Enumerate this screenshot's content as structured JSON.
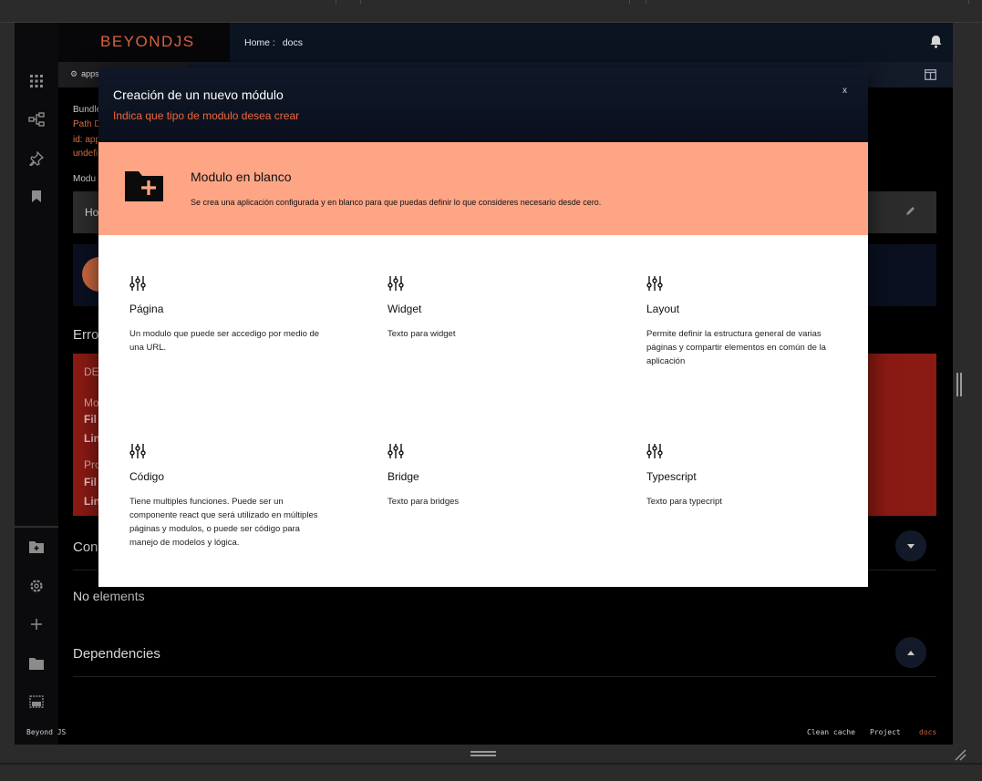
{
  "brand": {
    "name": "BEYONDJS"
  },
  "breadcrumb": {
    "home": "Home :",
    "current": "docs"
  },
  "tab": {
    "label": "apps"
  },
  "background": {
    "bundle_label": "Bundle",
    "path_label": "Path D",
    "id_label": "id: app",
    "undef_label": "undefi",
    "modules_label": "Modu",
    "row_label": "Ho",
    "errors_title": "Erro",
    "red_lines": [
      "DE",
      "Mo",
      "Fil",
      "Lin",
      "Pro",
      "Fil",
      "Lin"
    ],
    "consumers_title": "Con",
    "no_elements": "No elements",
    "dependencies_title": "Dependencies"
  },
  "footer": {
    "left": "Beyond JS",
    "clean_cache": "Clean cache",
    "project": "Project",
    "docs": "docs"
  },
  "modal": {
    "title": "Creación de un nuevo módulo",
    "subtitle": "Indica que tipo de modulo desea crear",
    "close": "x",
    "blank": {
      "title": "Modulo en blanco",
      "description": "Se crea una aplicación configurada y en blanco para que puedas definir lo que consideres necesario desde cero."
    },
    "options": [
      {
        "title": "Página",
        "description": "Un modulo que puede ser accedigo por medio de una URL.",
        "icon": "sliders-icon"
      },
      {
        "title": "Widget",
        "description": "Texto para widget",
        "icon": "sliders-icon"
      },
      {
        "title": "Layout",
        "description": "Permite definir la estructura general de varias páginas y compartir elementos en común de la aplicación",
        "icon": "sliders-icon"
      },
      {
        "title": "Código",
        "description": "Tiene multiples funciones. Puede ser un componente react que será utilizado en múltiples páginas y modulos, o puede ser código para manejo de modelos y lógica.",
        "icon": "sliders-icon"
      },
      {
        "title": "Bridge",
        "description": "Texto para bridges",
        "icon": "sliders-icon"
      },
      {
        "title": "Typescript",
        "description": "Texto para typecript",
        "icon": "sliders-icon"
      }
    ]
  },
  "colors": {
    "accent": "#f2673a",
    "blank_card": "#fea585",
    "brand": "#d9623b"
  }
}
